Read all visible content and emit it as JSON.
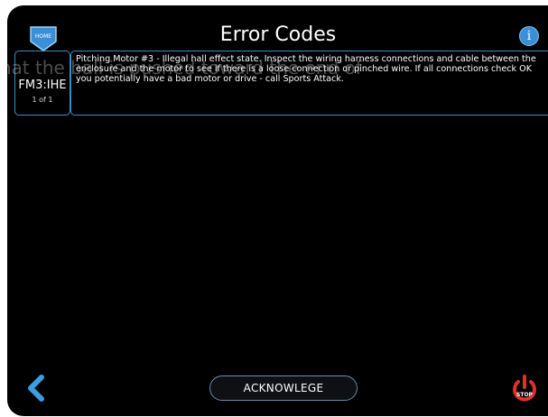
{
  "header": {
    "title": "Error Codes",
    "home_label": "HOME",
    "info_label": "i"
  },
  "error": {
    "code": "FM3:IHE",
    "counter": "1 of 1",
    "description": "Pitching Motor #3 - Illegal hall effect state. Inspect the wiring harness connections and cable between the enclosure and the motor to see if there is a loose connection or pinched wire. If all connections check OK you potentially have a bad motor or drive - call Sports Attack."
  },
  "overlay_text": "that the ball is pushed toward the end of",
  "footer": {
    "acknowledge_label": "ACKNOWLEGE",
    "stop_label": "STOP"
  },
  "colors": {
    "accent": "#3a8fd6",
    "stop": "#e0322a"
  }
}
